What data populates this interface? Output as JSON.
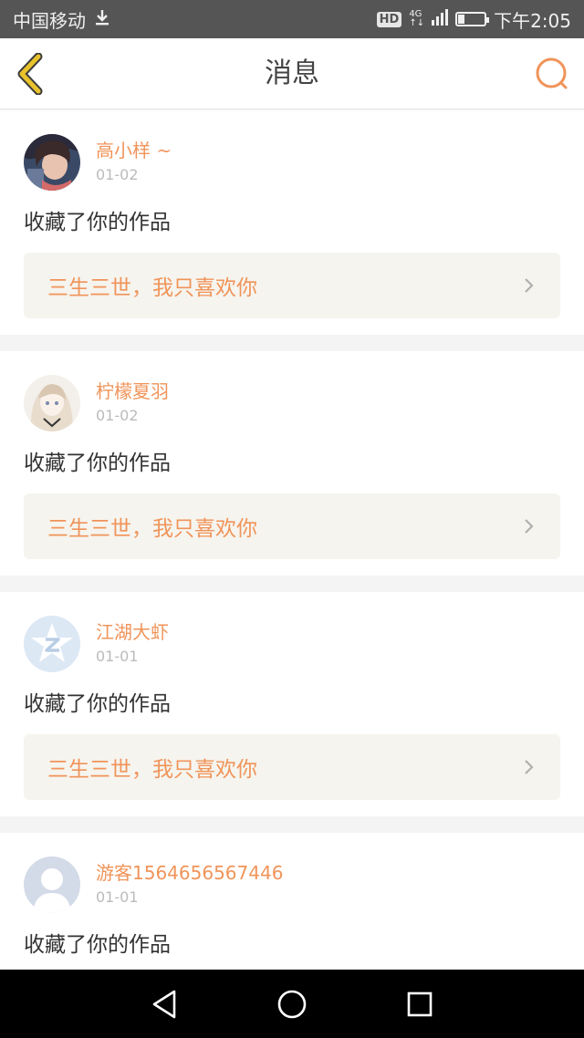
{
  "status_bar": {
    "carrier": "中国移动",
    "hd": "HD",
    "network_top": "4G",
    "network_bottom": "↑↓",
    "time": "下午2:05",
    "battery_level": 0.25
  },
  "header": {
    "title": "消息",
    "back_icon": "chevron-left-icon",
    "search_icon": "search-icon"
  },
  "colors": {
    "accent": "#f0945a",
    "back_arrow": "#e8c22c"
  },
  "messages": [
    {
      "username": "高小样 ~",
      "date": "01-02",
      "action": "收藏了你的作品",
      "work_title": "三生三世，我只喜欢你"
    },
    {
      "username": "柠檬夏羽",
      "date": "01-02",
      "action": "收藏了你的作品",
      "work_title": "三生三世，我只喜欢你"
    },
    {
      "username": "江湖大虾",
      "date": "01-01",
      "action": "收藏了你的作品",
      "work_title": "三生三世，我只喜欢你"
    },
    {
      "username": "游客1564656567446",
      "date": "01-01",
      "action": "收藏了你的作品"
    }
  ],
  "nav": {
    "back_icon": "triangle-back-icon",
    "home_icon": "circle-home-icon",
    "recents_icon": "square-recents-icon"
  }
}
